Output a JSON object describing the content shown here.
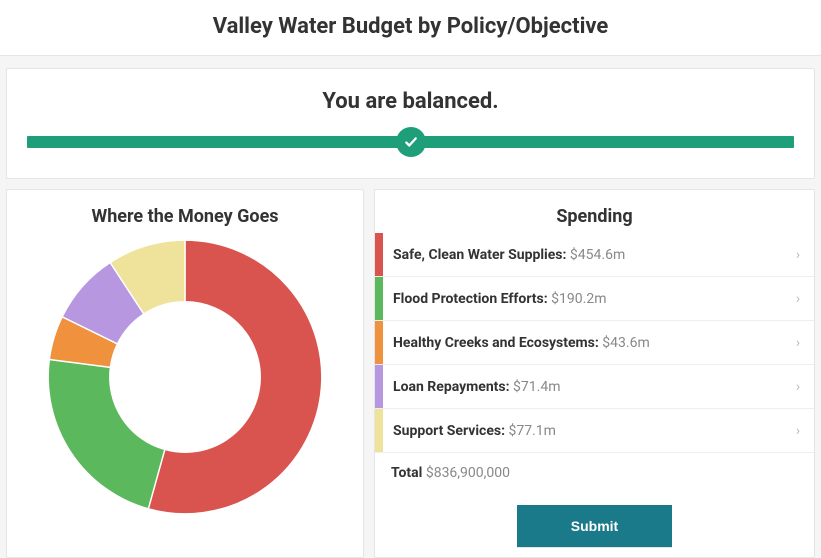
{
  "header": {
    "title": "Valley Water Budget by Policy/Objective"
  },
  "status": {
    "message": "You are balanced.",
    "icon": "check-icon"
  },
  "colors": {
    "accent": "#1f9e7a",
    "submit": "#1b7a8a",
    "slices": [
      "#d9534f",
      "#5cb85c",
      "#f0913e",
      "#b697e0",
      "#efe29a"
    ]
  },
  "chart_data": {
    "type": "pie",
    "title": "Where the Money Goes",
    "categories": [
      "Safe, Clean Water Supplies",
      "Flood Protection Efforts",
      "Healthy Creeks and Ecosystems",
      "Loan Repayments",
      "Support Services"
    ],
    "values": [
      454.6,
      190.2,
      43.6,
      71.4,
      77.1
    ],
    "unit": "million USD",
    "total": 836.9,
    "inner_radius_ratio": 0.55
  },
  "spending": {
    "title": "Spending",
    "items": [
      {
        "label": "Safe, Clean Water Supplies:",
        "amount": "$454.6m",
        "color": "#d9534f"
      },
      {
        "label": "Flood Protection Efforts:",
        "amount": "$190.2m",
        "color": "#5cb85c"
      },
      {
        "label": "Healthy Creeks and Ecosystems:",
        "amount": "$43.6m",
        "color": "#f0913e"
      },
      {
        "label": "Loan Repayments:",
        "amount": "$71.4m",
        "color": "#b697e0"
      },
      {
        "label": "Support Services:",
        "amount": "$77.1m",
        "color": "#efe29a"
      }
    ],
    "total_label": "Total",
    "total_value": "$836,900,000"
  },
  "actions": {
    "submit_label": "Submit"
  }
}
